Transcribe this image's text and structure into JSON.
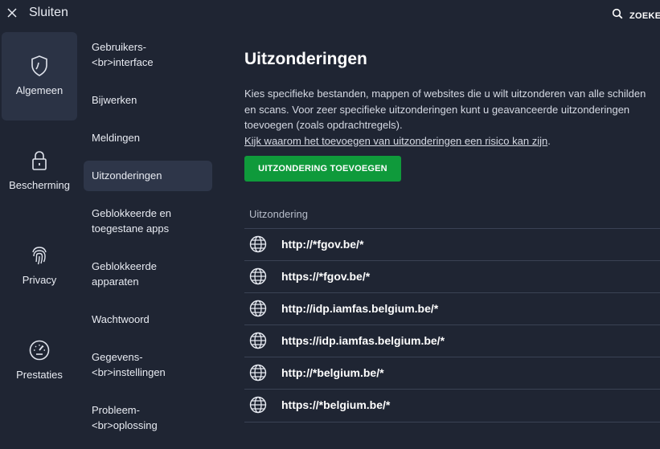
{
  "header": {
    "close_label": "Sluiten",
    "search_label": "ZOEKEN"
  },
  "categories": [
    {
      "label": "Algemeen",
      "icon": "shield-icon",
      "active": true
    },
    {
      "label": "Bescherming",
      "icon": "lock-icon",
      "active": false
    },
    {
      "label": "Privacy",
      "icon": "fingerprint-icon",
      "active": false
    },
    {
      "label": "Prestaties",
      "icon": "speedometer-icon",
      "active": false
    }
  ],
  "submenu": [
    {
      "line1": "Gebruikers-",
      "line2": "<br>interface"
    },
    {
      "line1": "Bijwerken",
      "line2": ""
    },
    {
      "line1": "Meldingen",
      "line2": ""
    },
    {
      "line1": "Uitzonderingen",
      "line2": "",
      "active": true
    },
    {
      "line1": "Geblokkeerde en",
      "line2": "toegestane apps"
    },
    {
      "line1": "Geblokkeerde",
      "line2": "apparaten"
    },
    {
      "line1": "Wachtwoord",
      "line2": ""
    },
    {
      "line1": "Gegevens-",
      "line2": "<br>instellingen"
    },
    {
      "line1": "Probleem-",
      "line2": "<br>oplossing"
    }
  ],
  "main": {
    "title": "Uitzonderingen",
    "description": "Kies specifieke bestanden, mappen of websites die u wilt uitzonderen van alle schilden en scans. Voor zeer specifieke uitzonderingen kunt u geavanceerde uitzonderingen toevoegen (zoals opdrachtregels).",
    "link_text": "Kijk waarom het toevoegen van uitzonderingen een risico kan zijn",
    "link_suffix": ".",
    "add_button": "UITZONDERING TOEVOEGEN",
    "column_header": "Uitzondering",
    "exceptions": [
      "http://*fgov.be/*",
      "https://*fgov.be/*",
      "http://idp.iamfas.belgium.be/*",
      "https://idp.iamfas.belgium.be/*",
      "http://*belgium.be/*",
      "https://*belgium.be/*"
    ]
  },
  "colors": {
    "background": "#1f2533",
    "active_category": "#2b3345",
    "active_submenu": "#2e3649",
    "add_button": "#0f9a3b",
    "divider": "#3a4254"
  }
}
